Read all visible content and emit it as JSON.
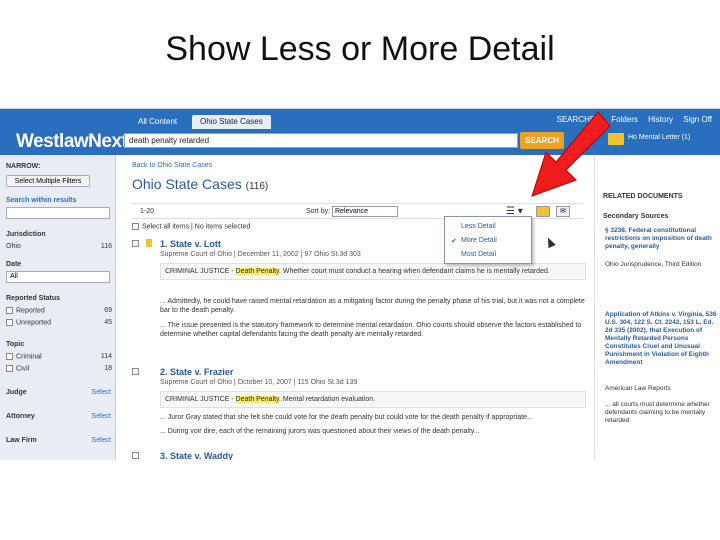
{
  "slide": {
    "title": "Show Less or More Detail"
  },
  "topbar": {
    "logo": "WestlawNext",
    "tabs": [
      "All Content",
      "Ohio State Cases"
    ],
    "links": [
      "SEARCHER",
      "Folders",
      "History",
      "Sign Off"
    ],
    "search_value": "death penalty retarded",
    "search_button": "SEARCH",
    "folder_label": "Ho Mental Letter (1)"
  },
  "left": {
    "narrow": "NARROW:",
    "select_filters": "Select Multiple Filters",
    "search_within": "Search within results",
    "jurisdiction": "Jurisdiction",
    "jur_item": "Ohio",
    "jur_count": "116",
    "date": "Date",
    "date_value": "All",
    "reported_status": "Reported Status",
    "reported": "Reported",
    "reported_count": "69",
    "unreported": "Unreported",
    "unreported_count": "45",
    "topic": "Topic",
    "topic1": "Criminal",
    "topic1_count": "114",
    "topic2": "Civil",
    "topic2_count": "18",
    "judge": "Judge",
    "attorney": "Attorney",
    "law_firm": "Law Firm",
    "select": "Select"
  },
  "main": {
    "breadcrumb": "Back to Ohio State Cases",
    "title": "Ohio State Cases",
    "count": "(116)",
    "range": "1-20",
    "sort_label": "Sort by:",
    "sort_value": "Relevance",
    "select_all": "Select all items",
    "no_items": "No items selected",
    "cases": [
      {
        "title": "1. State v. Lott",
        "meta": "Supreme Court of Ohio | December 11, 2002 | 97 Ohio St.3d 303",
        "syn_a": "CRIMINAL JUSTICE - ",
        "syn_hl": "Death Penalty",
        "syn_b": ". Whether court must conduct a hearing when defendant claims he is mentally retarded.",
        "ex1": "... Admittedly, he could have raised mental retardation as a mitigating factor during the penalty phase of his trial, but it was not a complete bar to the death penalty.",
        "ex2": "... The issue presented is the statutory framework to determine mental retardation. Ohio courts should observe the factors established to determine whether capital defendants facing the death penalty are mentally retarded."
      },
      {
        "title": "2. State v. Frazier",
        "meta": "Supreme Court of Ohio | October 10, 2007 | 115 Ohio St.3d 139",
        "syn_a": "CRIMINAL JUSTICE - ",
        "syn_hl": "Death Penalty",
        "syn_b": ". Mental retardation evaluation.",
        "ex1": "... Juror Gray stated that she felt she could vote for the death penalty but could vote for the death penalty if appropriate...",
        "ex2": "... During voir dire, each of the remaining jurors was questioned about their views of the death penalty..."
      },
      {
        "title": "3. State v. Waddy"
      }
    ]
  },
  "view_menu": {
    "items": [
      "Less Detail",
      "More Detail",
      "Most Detail"
    ],
    "checked": "More Detail"
  },
  "right": {
    "related": "RELATED DOCUMENTS",
    "secondary": "Secondary Sources",
    "s1": "§ 3238. Federal constitutional restrictions on imposition of death penalty, generally",
    "s1_src": "Ohio Jurisprudence, Third Edition",
    "s2": "Application of Atkins v. Virginia, 536 U.S. 304, 122 S. Ct. 2242, 153 L. Ed. 2d 335 (2002), that Execution of Mentally Retarded Persons Constitutes Cruel and Unusual Punishment in Violation of Eighth Amendment",
    "s2_src": "American Law Reports",
    "s3": "... all courts must determine whether defendants claiming to be mentally retarded"
  }
}
